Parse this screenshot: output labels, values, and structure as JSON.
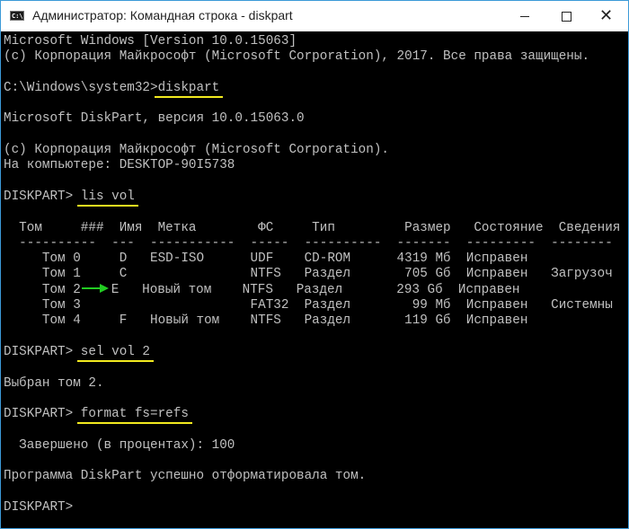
{
  "window": {
    "title": "Администратор: Командная строка - diskpart",
    "icon": "cmd-icon",
    "icon_text": "C:\\."
  },
  "console": {
    "lines": [
      {
        "text": "Microsoft Windows [Version 10.0.15063]"
      },
      {
        "text": "(c) Корпорация Майкрософт (Microsoft Corporation), 2017. Все права защищены."
      },
      {
        "text": ""
      },
      {
        "prompt": "C:\\Windows\\system32>",
        "command": "diskpart"
      },
      {
        "text": ""
      },
      {
        "text": "Microsoft DiskPart, версия 10.0.15063.0"
      },
      {
        "text": ""
      },
      {
        "text": "(c) Корпорация Майкрософт (Microsoft Corporation)."
      },
      {
        "text": "На компьютере: DESKTOP-90I5738"
      },
      {
        "text": ""
      },
      {
        "prompt": "DISKPART> ",
        "command": "lis vol"
      },
      {
        "text": ""
      },
      {
        "text": "  Том     ###  Имя  Метка        ФС     Тип         Размер   Состояние  Сведения"
      },
      {
        "text": "  ----------  ---  -----------  -----  ----------  -------  ---------  --------"
      },
      {
        "text": "     Том 0     D   ESD-ISO      UDF    CD-ROM      4319 Мб  Исправен"
      },
      {
        "text": "     Том 1     C                NTFS   Раздел       705 Gб  Исправен   Загрузоч"
      },
      {
        "text": "     Том 2",
        "arrow": true,
        "after": "E   Новый том    NTFS   Раздел       293 Gб  Исправен"
      },
      {
        "text": "     Том 3                      FAT32  Раздел        99 Мб  Исправен   Системны"
      },
      {
        "text": "     Том 4     F   Новый том    NTFS   Раздел       119 Gб  Исправен"
      },
      {
        "text": ""
      },
      {
        "prompt": "DISKPART> ",
        "command": "sel vol 2"
      },
      {
        "text": ""
      },
      {
        "text": "Выбран том 2."
      },
      {
        "text": ""
      },
      {
        "prompt": "DISKPART> ",
        "command": "format fs=refs"
      },
      {
        "text": ""
      },
      {
        "text": "  Завершено (в процентах): 100"
      },
      {
        "text": ""
      },
      {
        "text": "Программа DiskPart успешно отформатировала том."
      },
      {
        "text": ""
      },
      {
        "prompt": "DISKPART> ",
        "command": ""
      }
    ]
  },
  "colors": {
    "underline": "#f2ea1f",
    "arrow": "#22cc22",
    "text": "#c0c0c0"
  }
}
